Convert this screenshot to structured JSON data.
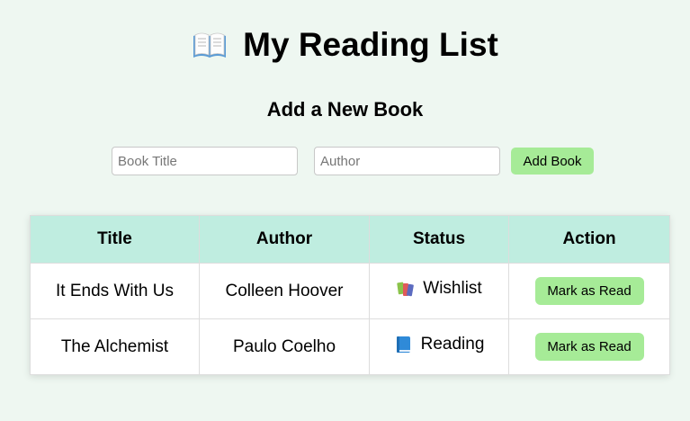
{
  "header": {
    "title": "My Reading List",
    "icon": "open-book-icon"
  },
  "form": {
    "heading": "Add a New Book",
    "title_placeholder": "Book Title",
    "author_placeholder": "Author",
    "title_value": "",
    "author_value": "",
    "add_label": "Add Book"
  },
  "table": {
    "columns": [
      "Title",
      "Author",
      "Status",
      "Action"
    ],
    "rows": [
      {
        "title": "It Ends With Us",
        "author": "Colleen Hoover",
        "status": "Wishlist",
        "status_icon": "books-stack-icon",
        "action": "Mark as Read"
      },
      {
        "title": "The Alchemist",
        "author": "Paulo Coelho",
        "status": "Reading",
        "status_icon": "blue-book-icon",
        "action": "Mark as Read"
      }
    ]
  },
  "colors": {
    "background": "#eef7f1",
    "header_row": "#bfede0",
    "button": "#a6eb97"
  }
}
